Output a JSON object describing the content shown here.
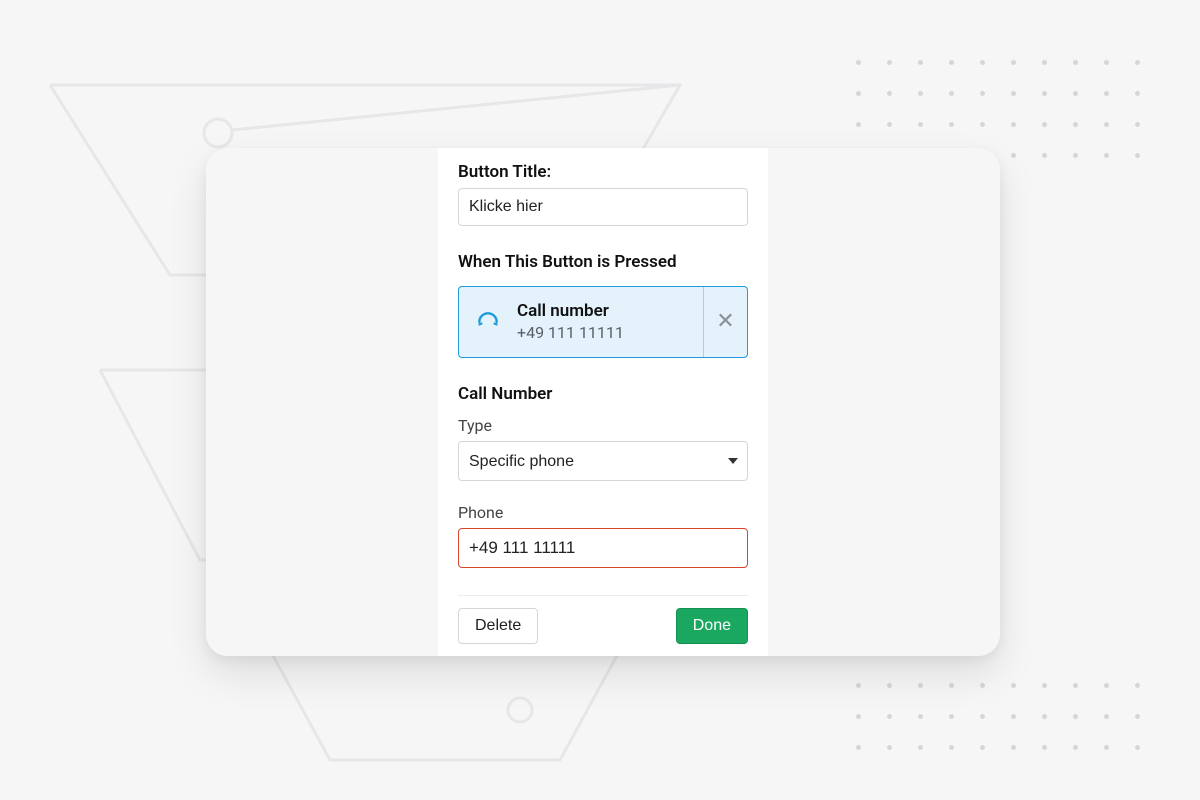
{
  "form": {
    "button_title_label": "Button Title:",
    "button_title_value": "Klicke hier",
    "when_pressed_label": "When This Button is Pressed",
    "action": {
      "title": "Call number",
      "subtitle": "+49 111 11111"
    },
    "call_number_section_label": "Call Number",
    "type_label": "Type",
    "type_value": "Specific phone",
    "phone_label": "Phone",
    "phone_value": "+49 111 11111"
  },
  "footer": {
    "delete_label": "Delete",
    "done_label": "Done"
  },
  "icons": {
    "phone": "phone-icon",
    "close": "close-icon",
    "caret": "caret-down-icon"
  }
}
